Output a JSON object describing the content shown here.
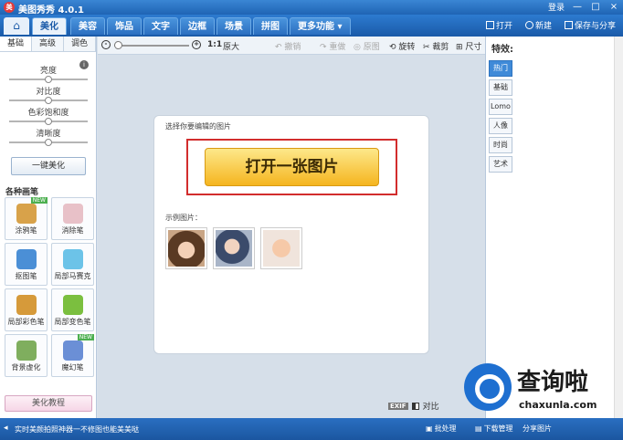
{
  "titlebar": {
    "logo": "美",
    "title": "美图秀秀 4.0.1",
    "login": "登录",
    "min": "—",
    "max": "□",
    "close": "×"
  },
  "menubar": {
    "home_icon": "⌂",
    "tabs": [
      "美化",
      "美容",
      "饰品",
      "文字",
      "边框",
      "场景",
      "拼图",
      "更多功能 ▾"
    ],
    "open": "打开",
    "new": "新建",
    "save_share": "保存与分享"
  },
  "left": {
    "tabs": [
      "基础",
      "高级",
      "调色"
    ],
    "sliders": [
      {
        "label": "亮度",
        "value": 0.5
      },
      {
        "label": "对比度",
        "value": 0.5
      },
      {
        "label": "色彩饱和度",
        "value": 0.5
      },
      {
        "label": "清晰度",
        "value": 0.5
      }
    ],
    "onekey": "一键美化",
    "section": "各种画笔",
    "tools": [
      {
        "label": "涂鸦笔",
        "badge": "NEW",
        "color": "#d8a24a"
      },
      {
        "label": "消除笔",
        "badge": "",
        "color": "#e8c1c8"
      },
      {
        "label": "抠图笔",
        "badge": "",
        "color": "#4b8fd6"
      },
      {
        "label": "局部马赛克",
        "badge": "",
        "color": "#6cc3e8"
      },
      {
        "label": "局部彩色笔",
        "badge": "",
        "color": "#d69a3a"
      },
      {
        "label": "局部变色笔",
        "badge": "",
        "color": "#7bbf3f"
      },
      {
        "label": "背景虚化",
        "badge": "",
        "color": "#7fae5e"
      },
      {
        "label": "魔幻笔",
        "badge": "NEW",
        "color": "#6b8fd6"
      }
    ],
    "tutorial": "美化教程"
  },
  "toolbar": {
    "zoom_out": "-",
    "zoom_in": "+",
    "zoom_value": 0.05,
    "ratio": "1:1",
    "original": "原大",
    "undo": "撤销",
    "redo": "重做",
    "source": "原图",
    "rotate": "旋转",
    "crop": "裁剪",
    "size": "尺寸"
  },
  "canvas": {
    "prompt": "选择你要编辑的图片",
    "open_button": "打开一张图片",
    "sample_title": "示例图片：",
    "exif": "EXIF",
    "compare": "对比"
  },
  "right": {
    "title": "特效:",
    "tabs": [
      "热门",
      "基础",
      "Lomo",
      "人像",
      "时尚",
      "艺术"
    ]
  },
  "statusbar": {
    "tip": "实时美颜拍照神器一不修图也能美美哒",
    "batch": "批处理",
    "downloads": "下载管理",
    "share": "分享图片"
  }
}
